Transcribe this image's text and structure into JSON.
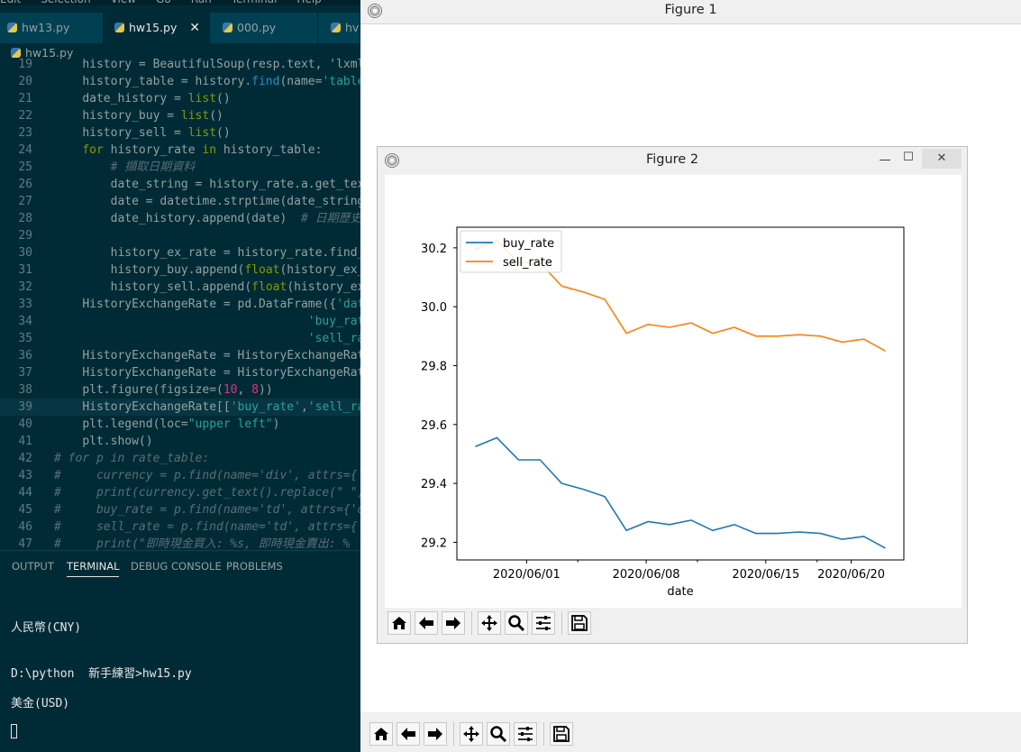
{
  "vscode": {
    "menu": [
      "Edit",
      "Selection",
      "View",
      "Go",
      "Run",
      "Terminal",
      "Help"
    ],
    "tabs": [
      {
        "label": "hw13.py",
        "active": false
      },
      {
        "label": "hw15.py",
        "active": true
      },
      {
        "label": "000.py",
        "active": false
      },
      {
        "label": "hv",
        "active": false
      }
    ],
    "breadcrumb": "hw15.py",
    "panel_tabs": [
      "OUTPUT",
      "TERMINAL",
      "DEBUG CONSOLE",
      "PROBLEMS"
    ],
    "terminal_lines": [
      "人民幣(CNY)",
      "D:\\python  新手練習>hw15.py",
      "美金(USD)"
    ]
  },
  "code_lines": [
    {
      "n": "19",
      "indent": 1,
      "tokens": [
        [
          "t",
          "history = BeautifulSoup(resp.text, 'lxml')"
        ]
      ]
    },
    {
      "n": "20",
      "indent": 1,
      "tokens": [
        [
          "t",
          "history_table = history."
        ],
        [
          "f",
          "find"
        ],
        [
          "t",
          "(name="
        ],
        [
          "s",
          "'table'"
        ]
      ]
    },
    {
      "n": "21",
      "indent": 1,
      "tokens": [
        [
          "t",
          "date_history = "
        ],
        [
          "k",
          "list"
        ],
        [
          "t",
          "()"
        ]
      ]
    },
    {
      "n": "22",
      "indent": 1,
      "tokens": [
        [
          "t",
          "history_buy = "
        ],
        [
          "k",
          "list"
        ],
        [
          "t",
          "()"
        ]
      ]
    },
    {
      "n": "23",
      "indent": 1,
      "tokens": [
        [
          "t",
          "history_sell = "
        ],
        [
          "k",
          "list"
        ],
        [
          "t",
          "()"
        ]
      ]
    },
    {
      "n": "24",
      "indent": 1,
      "tokens": [
        [
          "k",
          "for"
        ],
        [
          "t",
          " history_rate "
        ],
        [
          "k",
          "in"
        ],
        [
          "t",
          " history_table:"
        ]
      ]
    },
    {
      "n": "25",
      "indent": 2,
      "tokens": [
        [
          "c",
          "# 擷取日期資料"
        ]
      ]
    },
    {
      "n": "26",
      "indent": 2,
      "tokens": [
        [
          "t",
          "date_string = history_rate.a.get_tex"
        ]
      ]
    },
    {
      "n": "27",
      "indent": 2,
      "tokens": [
        [
          "t",
          "date = datetime.strptime(date_string"
        ]
      ]
    },
    {
      "n": "28",
      "indent": 2,
      "tokens": [
        [
          "t",
          "date_history.append(date)  "
        ],
        [
          "c",
          "# 日期歷史"
        ]
      ]
    },
    {
      "n": "29",
      "indent": 0,
      "tokens": []
    },
    {
      "n": "30",
      "indent": 2,
      "tokens": [
        [
          "t",
          "history_ex_rate = history_rate.find_"
        ]
      ]
    },
    {
      "n": "31",
      "indent": 2,
      "tokens": [
        [
          "t",
          "history_buy.append("
        ],
        [
          "k",
          "float"
        ],
        [
          "t",
          "(history_ex_"
        ]
      ]
    },
    {
      "n": "32",
      "indent": 2,
      "tokens": [
        [
          "t",
          "history_sell.append("
        ],
        [
          "k",
          "float"
        ],
        [
          "t",
          "(history_ex"
        ]
      ]
    },
    {
      "n": "33",
      "indent": 1,
      "tokens": [
        [
          "t",
          "HistoryExchangeRate = pd.DataFrame({"
        ],
        [
          "s",
          "'dat"
        ]
      ]
    },
    {
      "n": "34",
      "indent": 9,
      "tokens": [
        [
          "s",
          "'buy_rat"
        ]
      ]
    },
    {
      "n": "35",
      "indent": 9,
      "tokens": [
        [
          "s",
          "'sell_ra"
        ]
      ]
    },
    {
      "n": "36",
      "indent": 1,
      "tokens": [
        [
          "t",
          "HistoryExchangeRate = HistoryExchangeRat"
        ]
      ]
    },
    {
      "n": "37",
      "indent": 1,
      "tokens": [
        [
          "t",
          "HistoryExchangeRate = HistoryExchangeRat"
        ]
      ]
    },
    {
      "n": "38",
      "indent": 1,
      "tokens": [
        [
          "t",
          "plt.figure(figsize=("
        ],
        [
          "n",
          "10"
        ],
        [
          "t",
          ", "
        ],
        [
          "n",
          "8"
        ],
        [
          "t",
          "))"
        ]
      ]
    },
    {
      "n": "39",
      "indent": 1,
      "tokens": [
        [
          "t",
          "HistoryExchangeRate[["
        ],
        [
          "s",
          "'buy_rate'"
        ],
        [
          "t",
          ","
        ],
        [
          "s",
          "'sell_ra"
        ]
      ],
      "highlight": true
    },
    {
      "n": "40",
      "indent": 1,
      "tokens": [
        [
          "t",
          "plt.legend(loc="
        ],
        [
          "s",
          "\"upper left\""
        ],
        [
          "t",
          ")"
        ]
      ]
    },
    {
      "n": "41",
      "indent": 1,
      "tokens": [
        [
          "t",
          "plt.show()"
        ]
      ]
    },
    {
      "n": "42",
      "indent": 0,
      "tokens": [
        [
          "c",
          "# for p in rate_table:"
        ]
      ]
    },
    {
      "n": "43",
      "indent": 0,
      "tokens": [
        [
          "c",
          "#     currency = p.find(name='div', attrs={'"
        ]
      ]
    },
    {
      "n": "44",
      "indent": 0,
      "tokens": [
        [
          "c",
          "#     print(currency.get_text().replace(\" \","
        ]
      ]
    },
    {
      "n": "45",
      "indent": 0,
      "tokens": [
        [
          "c",
          "#     buy_rate = p.find(name='td', attrs={'d"
        ]
      ]
    },
    {
      "n": "46",
      "indent": 0,
      "tokens": [
        [
          "c",
          "#     sell_rate = p.find(name='td', attrs={'"
        ]
      ]
    },
    {
      "n": "47",
      "indent": 0,
      "tokens": [
        [
          "c",
          "#     print(\"即時現金買入: %s, 即時現金賣出: %"
        ]
      ]
    }
  ],
  "figure1": {
    "title": "Figure 1"
  },
  "figure2": {
    "title": "Figure 2",
    "window_buttons": {
      "minimize": "—",
      "maximize": "☐",
      "close": "✕"
    }
  },
  "toolbar_icons": [
    "home-icon",
    "back-icon",
    "forward-icon",
    "pan-icon",
    "zoom-icon",
    "configure-icon",
    "save-icon"
  ],
  "chart_data": {
    "type": "line",
    "title": "",
    "xlabel": "date",
    "ylabel": "",
    "x": [
      "2020/05/29",
      "2020/05/30",
      "2020/06/01",
      "2020/06/02",
      "2020/06/03",
      "2020/06/04",
      "2020/06/05",
      "2020/06/06",
      "2020/06/07",
      "2020/06/08",
      "2020/06/09",
      "2020/06/10",
      "2020/06/11",
      "2020/06/12",
      "2020/06/13",
      "2020/06/14",
      "2020/06/15",
      "2020/06/16",
      "2020/06/17",
      "2020/06/18",
      "2020/06/19",
      "2020/06/20",
      "2020/06/21",
      "2020/06/22"
    ],
    "x_ticks": [
      "2020/06/01",
      "2020/06/08",
      "2020/06/15",
      "2020/06/20"
    ],
    "y_ticks": [
      29.2,
      29.4,
      29.6,
      29.8,
      30.0,
      30.2
    ],
    "ylim": [
      29.14,
      30.27
    ],
    "legend_position": "upper left",
    "series": [
      {
        "name": "buy_rate",
        "color": "#1f77b4",
        "values": [
          29.525,
          29.555,
          29.48,
          29.48,
          29.4,
          29.38,
          29.355,
          29.24,
          29.27,
          29.26,
          29.275,
          29.24,
          29.26,
          29.23,
          29.23,
          29.235,
          29.23,
          29.21,
          29.22,
          29.18
        ]
      },
      {
        "name": "sell_rate",
        "color": "#ff7f0e",
        "values": [
          30.195,
          30.225,
          30.15,
          30.15,
          30.07,
          30.05,
          30.025,
          29.91,
          29.94,
          29.93,
          29.945,
          29.91,
          29.93,
          29.9,
          29.9,
          29.905,
          29.9,
          29.88,
          29.89,
          29.85
        ]
      }
    ]
  }
}
